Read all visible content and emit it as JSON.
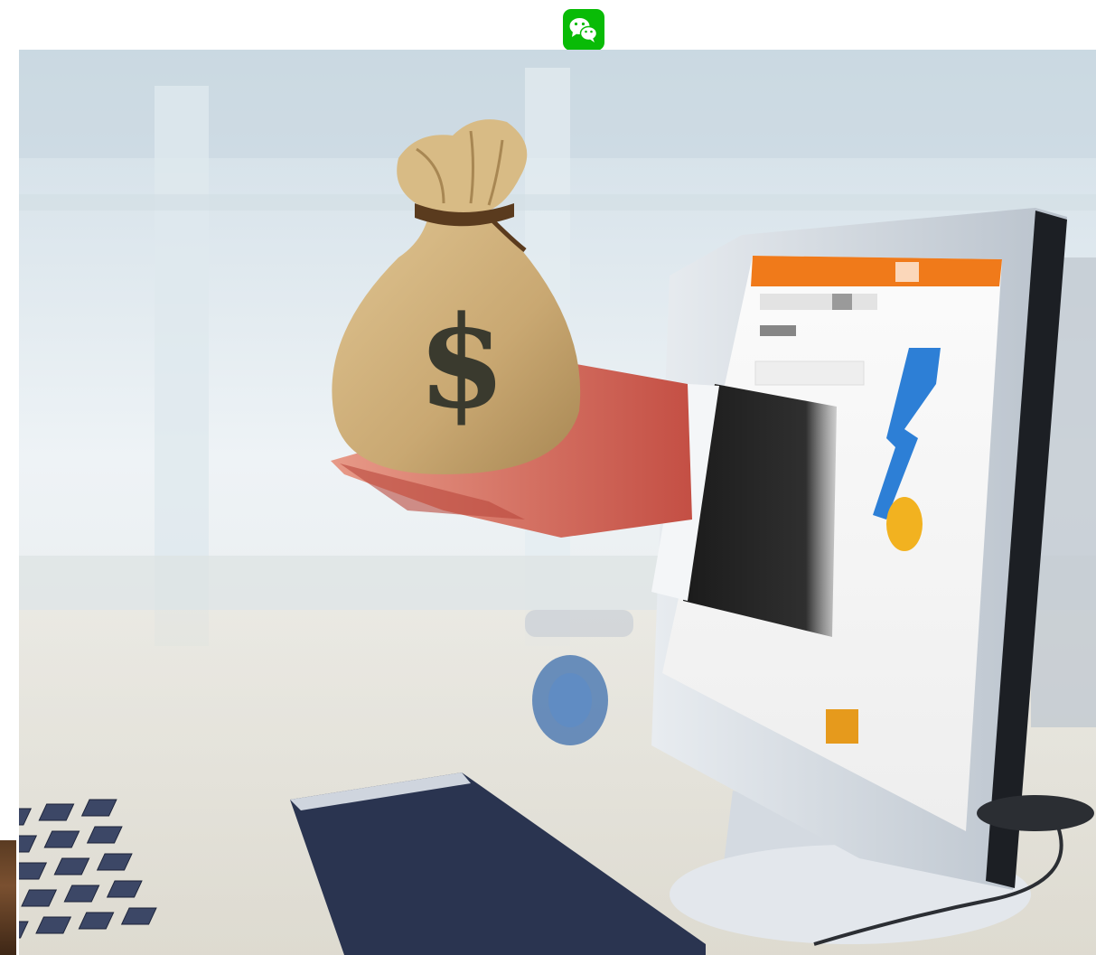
{
  "header": {
    "icon": "wechat-icon",
    "icon_color": "#09BB07"
  },
  "photo": {
    "subject": "hand-with-money-bag-from-monitor",
    "bag_symbol": "$",
    "palette": {
      "background": "#e8eef3",
      "bag": "#c9a872",
      "hand": "#d46a5a",
      "monitor": "#dfe4ea",
      "keyboard": "#2a3450",
      "screen_bar": "#f07a1a",
      "screen_glyph": "#2d7fd6"
    }
  }
}
